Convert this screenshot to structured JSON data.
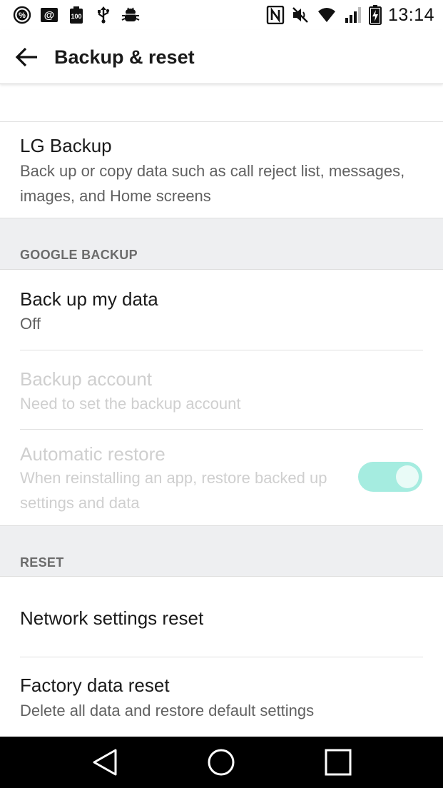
{
  "status_bar": {
    "time": "13:14",
    "left_icons": [
      "percent-icon",
      "at-icon",
      "battery-100-icon",
      "usb-icon",
      "android-debug-icon"
    ],
    "right_icons": [
      "nfc-icon",
      "mute-icon",
      "wifi-icon",
      "signal-icon",
      "battery-charging-icon"
    ]
  },
  "app_bar": {
    "back_icon": "arrow-back-icon",
    "title": "Backup & reset"
  },
  "lg_backup": {
    "title": "LG Backup",
    "subtitle": "Back up or copy data such as call reject list, messages, images, and Home screens"
  },
  "google_backup": {
    "header": "GOOGLE BACKUP",
    "back_up_my_data": {
      "title": "Back up my data",
      "value": "Off"
    },
    "backup_account": {
      "title": "Backup account",
      "subtitle": "Need to set the backup account",
      "enabled": false
    },
    "automatic_restore": {
      "title": "Automatic restore",
      "subtitle": "When reinstalling an app, restore backed up settings and data",
      "enabled": false,
      "toggle_on": true
    }
  },
  "reset": {
    "header": "RESET",
    "network_settings_reset": {
      "title": "Network settings reset"
    },
    "factory_data_reset": {
      "title": "Factory data reset",
      "subtitle": "Delete all data and restore default settings"
    }
  },
  "colors": {
    "toggle_track": "#a5ece0",
    "toggle_knob": "#e9fbf7",
    "section_background": "#eeeff1"
  },
  "nav_bar": {
    "buttons": [
      "back-triangle-icon",
      "home-circle-icon",
      "recents-square-icon"
    ]
  }
}
